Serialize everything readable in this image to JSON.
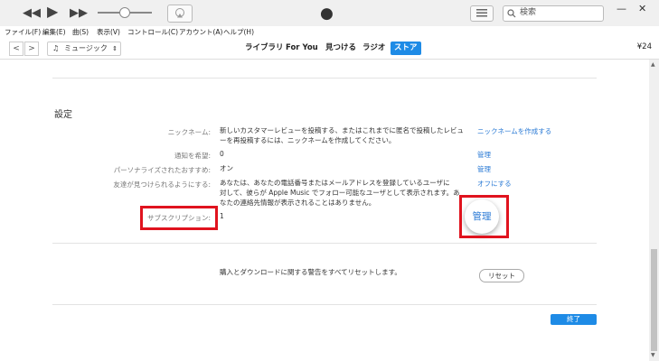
{
  "player": {
    "airplay_icon": "airplay-icon"
  },
  "search": {
    "placeholder": "検索"
  },
  "menu": [
    "ファイル(F)",
    "編集(E)",
    "曲(S)",
    "表示(V)",
    "コントロール(C)",
    "アカウント(A)",
    "ヘルプ(H)"
  ],
  "nav": {
    "media_kind": "ミュージック",
    "tabs": [
      "ライブラリ",
      "For You",
      "見つける",
      "ラジオ",
      "ストア"
    ],
    "active_tab": "ストア",
    "balance": "¥24"
  },
  "settings": {
    "title": "設定",
    "nickname": {
      "label": "ニックネーム:",
      "text_line1": "新しいカスタマーレビューを投稿する、またはこれまでに匿名で投稿したレビュ",
      "text_line2": "ーを再投稿するには、ニックネームを作成してください。",
      "link": "ニックネームを作成する"
    },
    "notify": {
      "label": "通知を希望:",
      "value": "0",
      "link": "管理"
    },
    "personalized": {
      "label": "パーソナライズされたおすすめ:",
      "value": "オン",
      "link": "管理"
    },
    "discover": {
      "label": "友達が見つけられるようにする:",
      "text_line1": "あなたは、あなたの電話番号またはメールアドレスを登録しているユーザに",
      "text_line2": "対して、彼らが Apple Music でフォロー可能なユーザとして表示されます。あ",
      "text_line3": "なたの連絡先情報が表示されることはありません。",
      "link": "オフにする"
    },
    "subscription": {
      "label": "サブスクリプション:",
      "value": "1",
      "link": "管理"
    },
    "reset": {
      "text": "購入とダウンロードに関する警告をすべてリセットします。",
      "button": "リセット"
    },
    "done_button": "終了"
  },
  "highlight_color": "#e0131e",
  "accent_color": "#1e8be6"
}
